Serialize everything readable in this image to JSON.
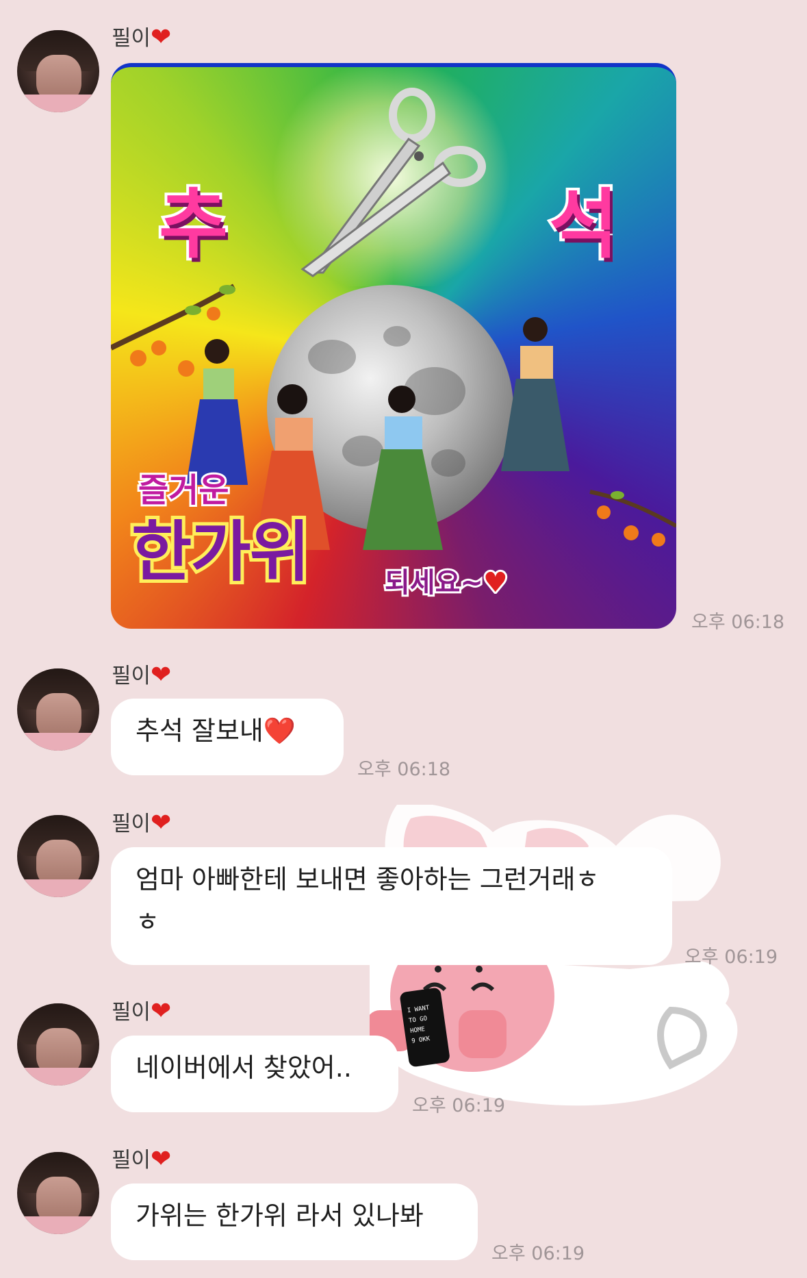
{
  "messages": [
    {
      "sender": "필이",
      "type": "image",
      "image": {
        "text_left": "추",
        "text_right": "석",
        "text_sub1": "즐거운",
        "text_sub2": "한가위",
        "text_sub3": "되세요~",
        "icon": "chuseok-greeting-image"
      },
      "time": "오후 06:18"
    },
    {
      "sender": "필이",
      "type": "text",
      "text": "추석 잘보내❤️",
      "time": "오후 06:18"
    },
    {
      "sender": "필이",
      "type": "text",
      "text_line1": "엄마 아빠한테 보내면 좋아하는 그런거래ㅎ",
      "text_line2": "ㅎ",
      "time": "오후 06:19"
    },
    {
      "sender": "필이",
      "type": "text",
      "text": "네이버에서 찾았어..",
      "time": "오후 06:19"
    },
    {
      "sender": "필이",
      "type": "text",
      "text": "가위는 한가위 라서 있나봐",
      "time": "오후 06:19"
    }
  ],
  "wallpaper": {
    "sticker_text": "I WANT TO GO HOME 9 OKK"
  },
  "colors": {
    "background": "#f1dfe0",
    "bubble": "#ffffff",
    "heart": "#e0201f",
    "time": "#a09597"
  }
}
